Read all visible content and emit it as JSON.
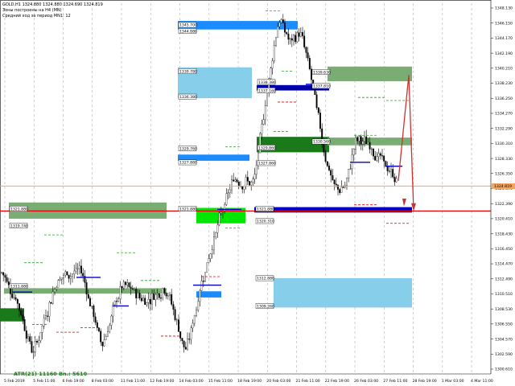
{
  "header": {
    "symbol_line": "GOLD,H1  1324.880 1324.880 1324.690 1324.819",
    "line2": "Зоны построены на H4 (MN)",
    "line3": "Средний ход за период MN1: 12"
  },
  "atr_label": "ATR(21) 11160  Bn.: 5610",
  "current_price_label": "1324.819",
  "colors": {
    "bull_candle": "#000000",
    "bear_candle": "#000000",
    "zone_blue": "#1a8cff",
    "zone_lightblue": "#87ceeb",
    "zone_green": "#7aad73",
    "zone_darkgreen": "#1a7a1a",
    "zone_lime": "#00e600",
    "navy_line": "#0000cd",
    "red_line": "#e60000",
    "orange_line": "#f4a460",
    "grid": "#b0b0b0"
  },
  "chart_data": {
    "type": "candlestick",
    "ylim": [
      1300.5,
      1348.5
    ],
    "price_axis_ticks": [
      "1348.130",
      "1346.150",
      "1344.170",
      "1342.190",
      "1340.210",
      "1338.230",
      "1336.250",
      "1334.270",
      "1332.290",
      "1330.310",
      "1328.330",
      "1326.350",
      "1324.370",
      "1322.390",
      "1320.410",
      "1318.430",
      "1316.450",
      "1314.470",
      "1312.490",
      "1310.510",
      "1308.530",
      "1306.550",
      "1304.570",
      "1302.590",
      "1300.610"
    ],
    "time_axis_ticks": [
      "5 Feb 2019",
      "5 Feb 11:00",
      "6 Feb 19:00",
      "8 Feb 03:00",
      "11 Feb 11:00",
      "12 Feb 19:00",
      "14 Feb 03:00",
      "15 Feb 11:00",
      "18 Feb 19:00",
      "20 Feb 03:00",
      "21 Feb 11:00",
      "22 Feb 19:00",
      "26 Feb 03:00",
      "27 Feb 11:00",
      "28 Feb 19:00",
      "1 Mar 03:00",
      "4 Mar 11:00"
    ],
    "zone_labels": [
      {
        "text": "1345.700",
        "price": 1345.7
      },
      {
        "text": "1344.880",
        "price": 1344.9
      },
      {
        "text": "1339.780",
        "price": 1339.7
      },
      {
        "text": "1336.380",
        "price": 1336.4
      },
      {
        "text": "1339.630",
        "price": 1339.6
      },
      {
        "text": "1337.810",
        "price": 1337.8
      },
      {
        "text": "1338.380",
        "price": 1338.3
      },
      {
        "text": "1337.160",
        "price": 1337.2
      },
      {
        "text": "1329.760",
        "price": 1329.7
      },
      {
        "text": "1327.880",
        "price": 1327.9
      },
      {
        "text": "1329.860",
        "price": 1329.8
      },
      {
        "text": "1330.560",
        "price": 1330.6
      },
      {
        "text": "1327.860",
        "price": 1327.8
      },
      {
        "text": "1321.880",
        "price": 1321.9
      },
      {
        "text": "1321.880",
        "price": 1321.9
      },
      {
        "text": "1320.310",
        "price": 1320.3
      },
      {
        "text": "1319.740",
        "price": 1319.7
      },
      {
        "text": "1312.880",
        "price": 1312.9
      },
      {
        "text": "1309.260",
        "price": 1309.3
      },
      {
        "text": "1311.880",
        "price": 1311.9
      },
      {
        "text": "1321.880",
        "price": 1321.9
      }
    ],
    "current_price": 1324.819
  }
}
